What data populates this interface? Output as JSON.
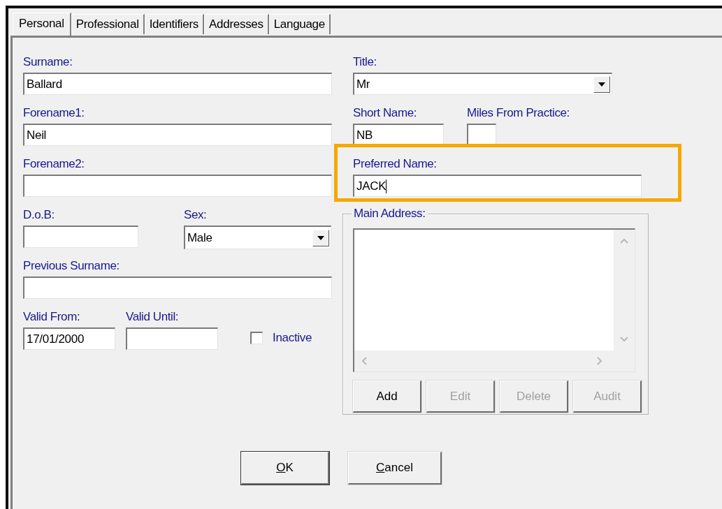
{
  "tabs": [
    {
      "label": "Personal",
      "selected": true
    },
    {
      "label": "Professional",
      "selected": false
    },
    {
      "label": "Identifiers",
      "selected": false
    },
    {
      "label": "Addresses",
      "selected": false
    },
    {
      "label": "Language",
      "selected": false
    }
  ],
  "left_rows": [
    [
      {
        "kind": "text",
        "label": "Surname:",
        "value": "Ballard"
      }
    ],
    [
      {
        "kind": "text",
        "label": "Forename1:",
        "value": "Neil"
      }
    ],
    [
      {
        "kind": "text",
        "label": "Forename2:"
      }
    ],
    [
      {
        "kind": "text",
        "label": "D.o.B:"
      },
      {
        "kind": "select",
        "label": "Sex:",
        "value": "Male"
      }
    ],
    [
      {
        "kind": "text",
        "label": "Previous Surname:"
      }
    ],
    [
      {
        "kind": "text",
        "label": "Valid From:",
        "value": "17/01/2000"
      },
      {
        "kind": "text",
        "label": "Valid Until:"
      },
      {
        "kind": "checkbox",
        "label": "Inactive",
        "checked": false
      }
    ]
  ],
  "right_rows": [
    [
      {
        "kind": "select",
        "label": "Title:",
        "value": "Mr"
      }
    ],
    [
      {
        "kind": "text",
        "label": "Short Name:",
        "value": "NB"
      },
      {
        "kind": "text",
        "label": "Miles From Practice:"
      }
    ],
    [
      {
        "kind": "text",
        "label": "Preferred Name:",
        "value": "JACK",
        "focused": true,
        "highlighted": true
      }
    ]
  ],
  "main_address": {
    "label": "Main Address:",
    "buttons": [
      {
        "label": "Add",
        "disabled": false
      },
      {
        "label": "Edit",
        "disabled": true
      },
      {
        "label": "Delete",
        "disabled": true
      },
      {
        "label": "Audit",
        "disabled": true
      }
    ]
  },
  "dialog_buttons": [
    {
      "label": "OK",
      "access_key_underlined": true
    },
    {
      "label": "Cancel",
      "access_key_underlined": true
    }
  ]
}
